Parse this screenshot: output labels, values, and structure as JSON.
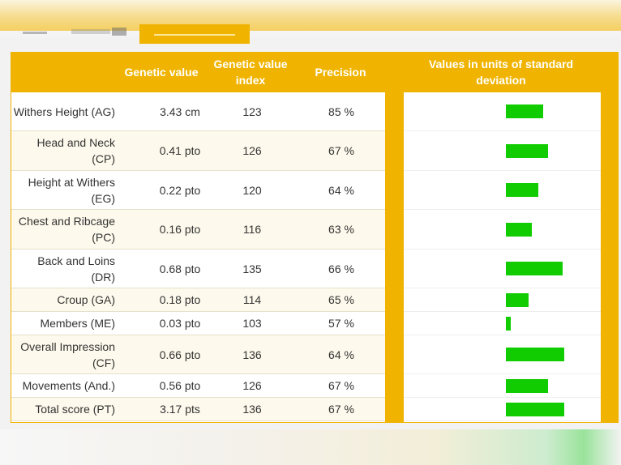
{
  "headers": {
    "genetic_value": "Genetic value",
    "genetic_value_index": "Genetic value index",
    "precision": "Precision",
    "sd_units": "Values in units of standard deviation"
  },
  "colors": {
    "accent": "#f0b400",
    "bar": "#10cc00"
  },
  "rows": [
    {
      "name": "Withers Height (AG)",
      "gv": "3.43 cm",
      "gvi": "123",
      "precision": "85 %",
      "sd": 1.15
    },
    {
      "name": "Head and Neck (CP)",
      "gv": "0.41 pto",
      "gvi": "126",
      "precision": "67 %",
      "sd": 1.3
    },
    {
      "name": "Height at Withers (EG)",
      "gv": "0.22 pto",
      "gvi": "120",
      "precision": "64 %",
      "sd": 1.0
    },
    {
      "name": "Chest and Ribcage (PC)",
      "gv": "0.16 pto",
      "gvi": "116",
      "precision": "63 %",
      "sd": 0.8
    },
    {
      "name": "Back and Loins (DR)",
      "gv": "0.68 pto",
      "gvi": "135",
      "precision": "66 %",
      "sd": 1.75
    },
    {
      "name": "Croup (GA)",
      "gv": "0.18 pto",
      "gvi": "114",
      "precision": "65 %",
      "sd": 0.7
    },
    {
      "name": "Members (ME)",
      "gv": "0.03 pto",
      "gvi": "103",
      "precision": "57 %",
      "sd": 0.15
    },
    {
      "name": "Overall Impression (CF)",
      "gv": "0.66 pto",
      "gvi": "136",
      "precision": "64 %",
      "sd": 1.8
    },
    {
      "name": "Movements (And.)",
      "gv": "0.56 pto",
      "gvi": "126",
      "precision": "67 %",
      "sd": 1.3
    },
    {
      "name": "Total score (PT)",
      "gv": "3.17 pts",
      "gvi": "136",
      "precision": "67 %",
      "sd": 1.8
    }
  ]
}
